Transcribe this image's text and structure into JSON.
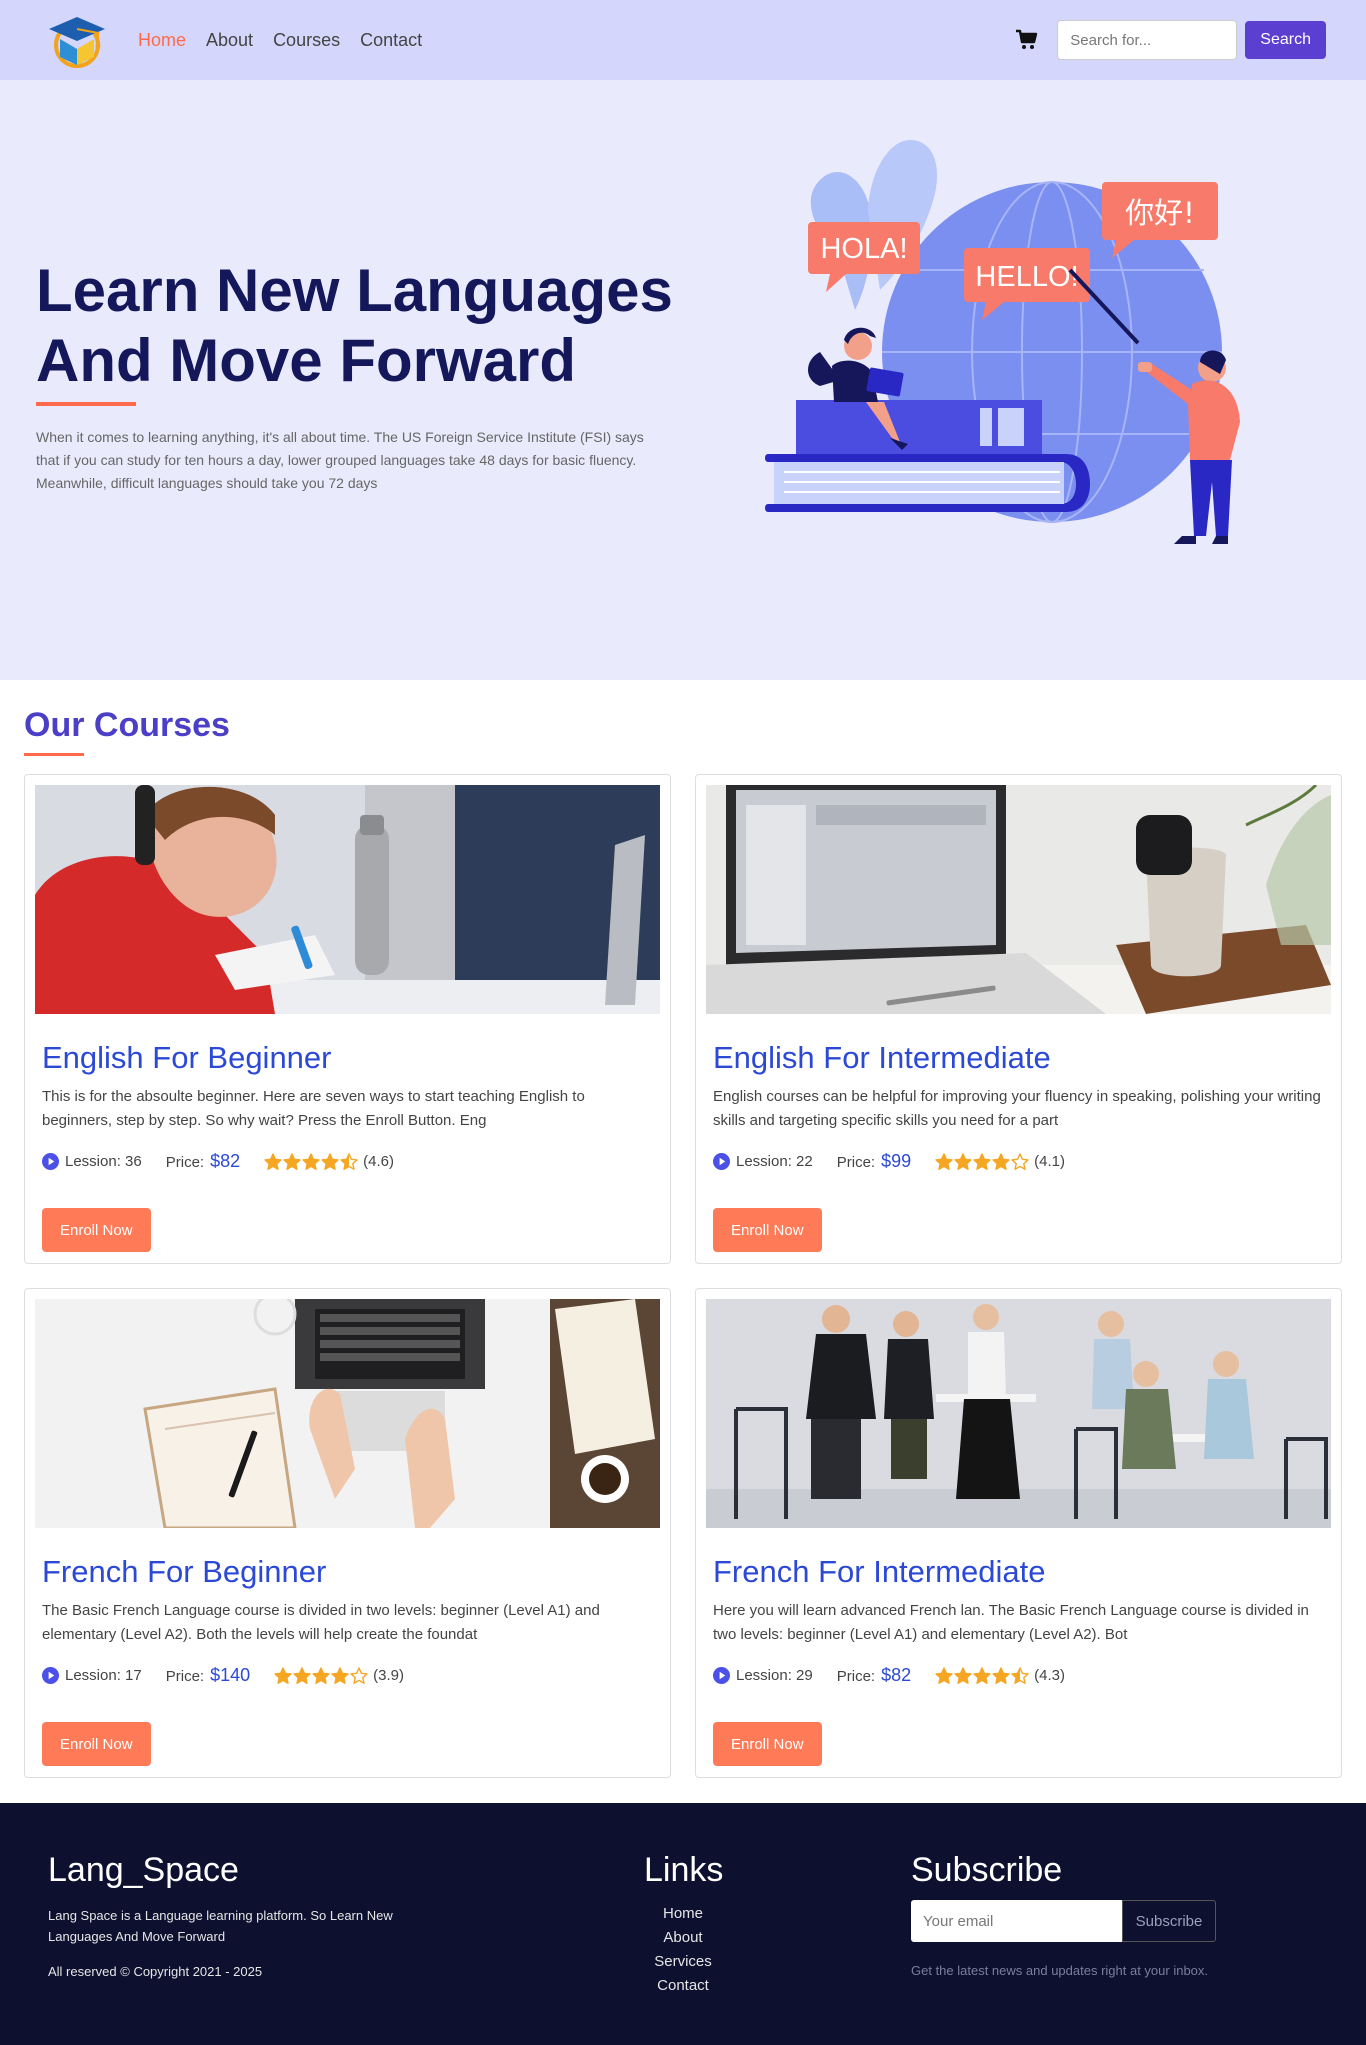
{
  "nav": {
    "links": [
      "Home",
      "About",
      "Courses",
      "Contact"
    ],
    "search_placeholder": "Search for...",
    "search_label": "Search"
  },
  "hero": {
    "title_line1": "Learn New Languages",
    "title_line2": "And Move Forward",
    "text": "When it comes to learning anything, it's all about time. The US Foreign Service Institute (FSI) says that if you can study for ten hours a day, lower grouped languages take 48 days for basic fluency. Meanwhile, difficult languages should take you 72 days",
    "bubbles": [
      "HOLA!",
      "HELLO!",
      "你好!"
    ]
  },
  "courses": {
    "title": "Our Courses",
    "lesson_label": "Lession:",
    "price_label": "Price:",
    "enroll_label": "Enroll Now",
    "items": [
      {
        "title": "English For Beginner",
        "desc": "This is for the absoulte beginner. Here are seven ways to start teaching English to beginners, step by step. So why wait? Press the Enroll Button. Eng",
        "lessons": "36",
        "price": "$82",
        "stars": 4.6,
        "rating": "(4.6)"
      },
      {
        "title": "English For Intermediate",
        "desc": "English courses can be helpful for improving your fluency in speaking, polishing your writing skills and targeting specific skills you need for a part",
        "lessons": "22",
        "price": "$99",
        "stars": 4.1,
        "rating": "(4.1)"
      },
      {
        "title": "French For Beginner",
        "desc": "The Basic French Language course is divided in two levels: beginner (Level A1) and elementary (Level A2). Both the levels will help create the foundat",
        "lessons": "17",
        "price": "$140",
        "stars": 3.9,
        "rating": "(3.9)"
      },
      {
        "title": "French For Intermediate",
        "desc": "Here you will learn advanced French lan. The Basic French Language course is divided in two levels: beginner (Level A1) and elementary (Level A2). Bot",
        "lessons": "29",
        "price": "$82",
        "stars": 4.3,
        "rating": "(4.3)"
      }
    ]
  },
  "footer": {
    "brand": "Lang_Space",
    "desc": "Lang Space is a Language learning platform. So Learn New Languages And Move Forward",
    "copyright": "All reserved © Copyright 2021 - 2025",
    "links_title": "Links",
    "links": [
      "Home",
      "About",
      "Services",
      "Contact"
    ],
    "subscribe_title": "Subscribe",
    "email_placeholder": "Your email",
    "subscribe_label": "Subscribe",
    "note": "Get the latest news and updates right at your inbox."
  },
  "colors": {
    "accent": "#ff6b4a",
    "primary": "#5a3fd1",
    "link_blue": "#2c49d6",
    "star": "#f5a623"
  }
}
